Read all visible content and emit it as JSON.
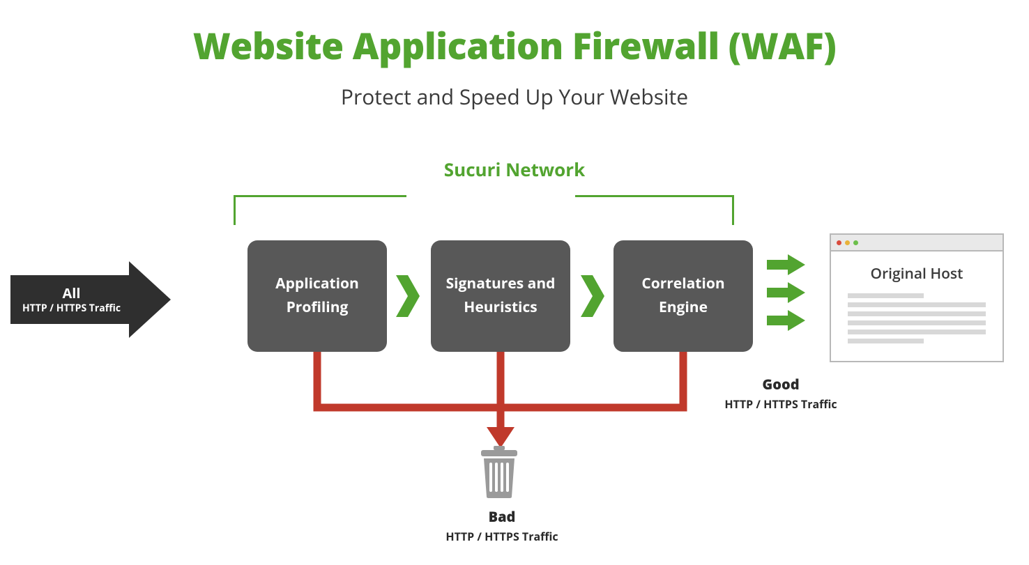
{
  "title": "Website Application Firewall (WAF)",
  "subtitle": "Protect and Speed Up Your Website",
  "network_label": "Sucuri Network",
  "input": {
    "line1": "All",
    "line2": "HTTP / HTTPS Traffic"
  },
  "nodes": {
    "n1": "Application Profiling",
    "n2": "Signatures and Heuristics",
    "n3": "Correlation Engine"
  },
  "output_host": "Original Host",
  "good": {
    "line1": "Good",
    "line2": "HTTP / HTTPS Traffic"
  },
  "bad": {
    "line1": "Bad",
    "line2": "HTTP / HTTPS Traffic"
  },
  "colors": {
    "green": "#52a430",
    "node": "#585858",
    "red": "#c0392b",
    "text": "#3a3a3a"
  }
}
